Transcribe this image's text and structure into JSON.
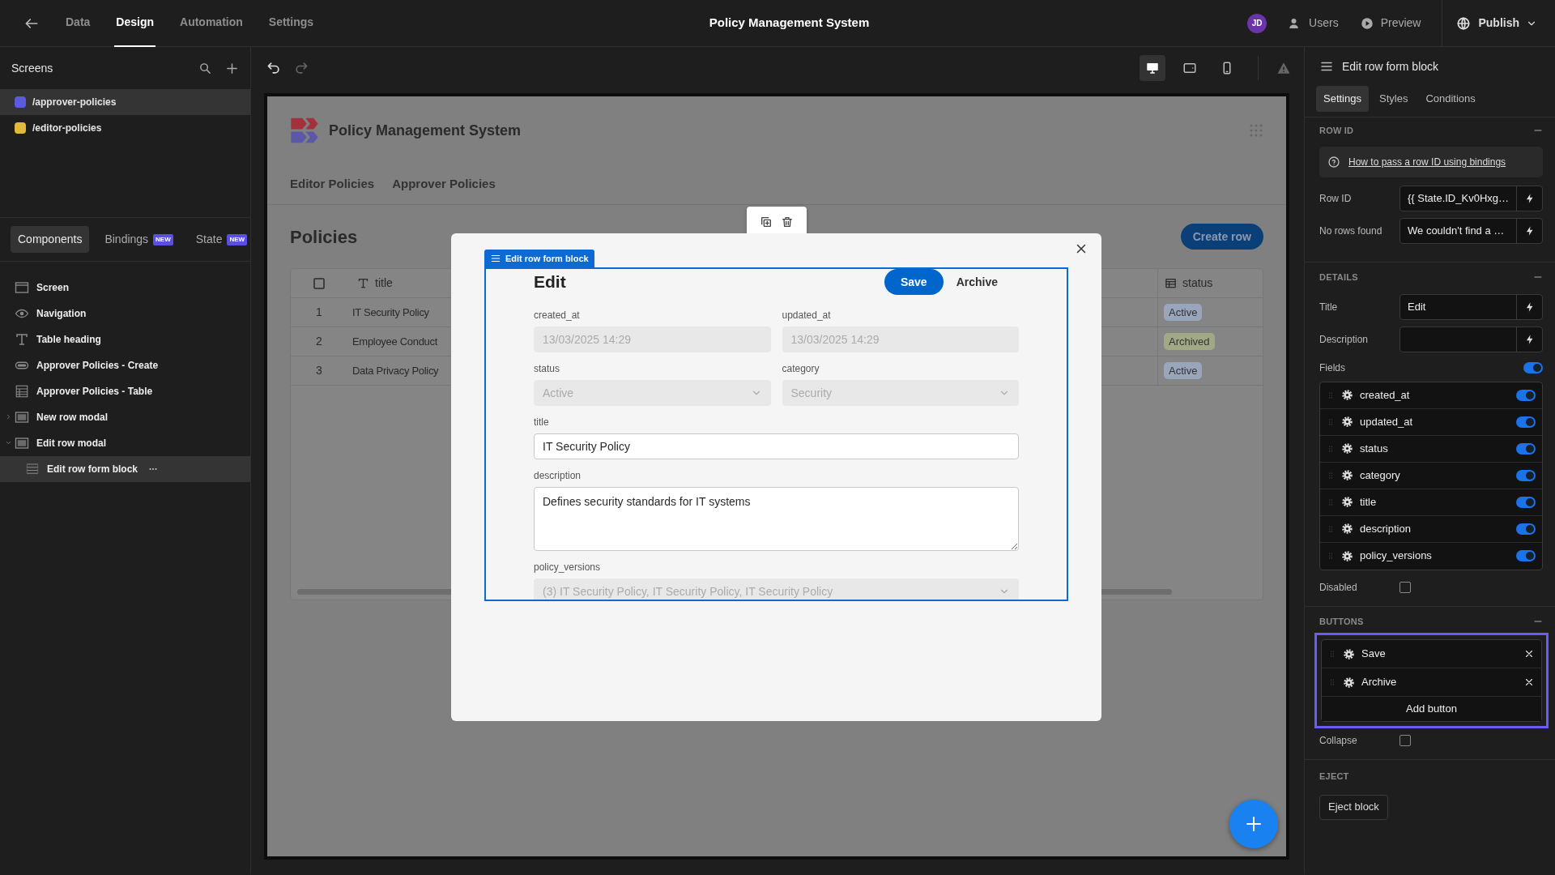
{
  "topbar": {
    "tabs": [
      {
        "label": "Data",
        "selected": false
      },
      {
        "label": "Design",
        "selected": true
      },
      {
        "label": "Automation",
        "selected": false
      },
      {
        "label": "Settings",
        "selected": false
      }
    ],
    "title": "Policy Management System",
    "avatar": "JD",
    "actions": [
      "Users",
      "Preview"
    ],
    "publish": "Publish"
  },
  "screens": {
    "title": "Screens",
    "items": [
      {
        "path": "/approver-policies",
        "color": "#5b5bdc",
        "selected": true
      },
      {
        "path": "/editor-policies",
        "color": "#e3b93c",
        "selected": false
      }
    ]
  },
  "component_tabs": [
    {
      "label": "Components",
      "selected": true
    },
    {
      "label": "Bindings",
      "badge": "NEW",
      "selected": false
    },
    {
      "label": "State",
      "badge": "NEW",
      "selected": false
    }
  ],
  "component_tree": [
    {
      "label": "Screen",
      "kind": "screen",
      "selected": false
    },
    {
      "label": "Navigation",
      "kind": "navigation",
      "selected": false
    },
    {
      "label": "Table heading",
      "kind": "text",
      "selected": false
    },
    {
      "label": "Approver Policies - Create",
      "kind": "button",
      "selected": false
    },
    {
      "label": "Approver Policies - Table",
      "kind": "table",
      "selected": false
    },
    {
      "label": "New row modal",
      "kind": "modal",
      "expanded": false,
      "selected": false
    },
    {
      "label": "Edit row modal",
      "kind": "modal",
      "expanded": true,
      "selected": false,
      "children": [
        {
          "label": "Edit row form block",
          "kind": "form",
          "selected": true
        }
      ]
    }
  ],
  "devices": [
    {
      "kind": "desktop",
      "selected": true
    },
    {
      "kind": "tablet",
      "selected": false
    },
    {
      "kind": "mobile",
      "selected": false
    }
  ],
  "preview": {
    "app_title": "Policy Management System",
    "nav": [
      "Editor Policies",
      "Approver Policies"
    ],
    "heading": "Policies",
    "create_button": "Create row",
    "table": {
      "columns": [
        "title",
        "status"
      ],
      "rows": [
        {
          "number": "1",
          "title": "IT Security Policy",
          "status": {
            "label": "Active",
            "color": "#98a5ba"
          }
        },
        {
          "number": "2",
          "title": "Employee Conduct",
          "status": {
            "label": "Archived",
            "color": "#a1a886"
          }
        },
        {
          "number": "3",
          "title": "Data Privacy Policy",
          "status": {
            "label": "Active",
            "color": "#98a5ba"
          }
        }
      ]
    }
  },
  "modal": {
    "block_label": "Edit row form block",
    "title": "Edit",
    "buttons": [
      {
        "label": "Save",
        "kind": "primary"
      },
      {
        "label": "Archive",
        "kind": "text"
      }
    ],
    "rows": [
      [
        {
          "label": "created_at",
          "kind": "text",
          "value": "13/03/2025 14:29",
          "disabled": true
        },
        {
          "label": "updated_at",
          "kind": "text",
          "value": "13/03/2025 14:29",
          "disabled": true
        }
      ],
      [
        {
          "label": "status",
          "kind": "select",
          "value": "Active",
          "disabled": true
        },
        {
          "label": "category",
          "kind": "select",
          "value": "Security",
          "disabled": true
        }
      ],
      [
        {
          "label": "title",
          "kind": "text",
          "value": "IT Security Policy",
          "disabled": false
        }
      ],
      [
        {
          "label": "description",
          "kind": "textarea",
          "value": "Defines security standards for IT systems",
          "disabled": false
        }
      ],
      [
        {
          "label": "policy_versions",
          "kind": "select",
          "value": "(3) IT Security Policy, IT Security Policy, IT Security Policy",
          "disabled": true
        }
      ]
    ]
  },
  "settings_panel": {
    "title": "Edit row form block",
    "tabs": [
      {
        "label": "Settings",
        "selected": true
      },
      {
        "label": "Styles",
        "selected": false
      },
      {
        "label": "Conditions",
        "selected": false
      }
    ],
    "row_id": {
      "title": "ROW ID",
      "help_link": "How to pass a row ID using bindings",
      "settings": [
        {
          "label": "Row ID",
          "value": "{{ State.ID_Kv0Hxg…"
        },
        {
          "label": "No rows found",
          "value": "We couldn't find a …"
        }
      ]
    },
    "details": {
      "title": "DETAILS",
      "settings": [
        {
          "label": "Title",
          "value": "Edit"
        },
        {
          "label": "Description"
        }
      ],
      "fields_label": "Fields",
      "fields_on": true,
      "fields": [
        {
          "name": "created_at",
          "on": true
        },
        {
          "name": "updated_at",
          "on": true
        },
        {
          "name": "status",
          "on": true
        },
        {
          "name": "category",
          "on": true
        },
        {
          "name": "title",
          "on": true
        },
        {
          "name": "description",
          "on": true
        },
        {
          "name": "policy_versions",
          "on": true
        }
      ],
      "disabled": {
        "label": "Disabled",
        "checked": false
      }
    },
    "buttons": {
      "title": "BUTTONS",
      "highlighted": true,
      "items": [
        "Save",
        "Archive"
      ],
      "add_label": "Add button",
      "collapse": {
        "label": "Collapse",
        "checked": false
      }
    },
    "eject": {
      "title": "EJECT",
      "button": "Eject block"
    }
  }
}
